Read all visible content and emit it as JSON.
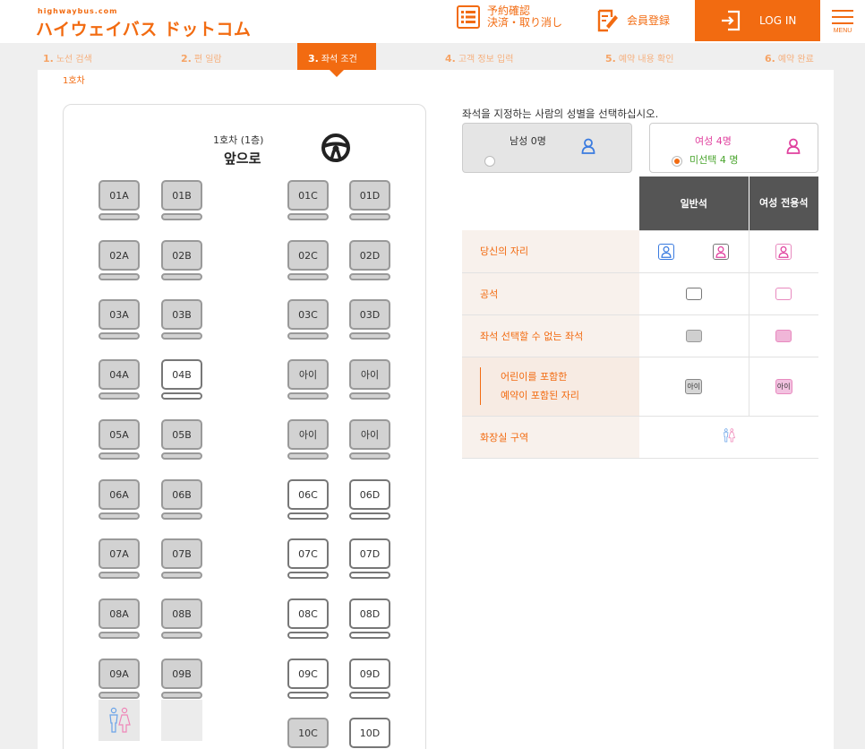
{
  "header": {
    "logo_small": "highwaybus.com",
    "logo": "ハイウェイバス ドットコム",
    "reservation_line1": "予約確認",
    "reservation_line2": "決済・取り消し",
    "member_label": "会員登録",
    "login_label": "LOG IN",
    "menu_label": "MENU",
    "accent": "#f26b11"
  },
  "steps": [
    {
      "num": "1.",
      "label": "노선 검색"
    },
    {
      "num": "2.",
      "label": "편 일람"
    },
    {
      "num": "3.",
      "label": "좌석 조건"
    },
    {
      "num": "4.",
      "label": "고객 정보 입력"
    },
    {
      "num": "5.",
      "label": "예약 내용 확인"
    },
    {
      "num": "6.",
      "label": "예약 완료"
    }
  ],
  "car_label": "1호차",
  "bus": {
    "title": "1호차 (1층)",
    "front": "앞으로",
    "seats": [
      {
        "label": "01A",
        "state": "occupied"
      },
      {
        "label": "01B",
        "state": "occupied"
      },
      {
        "label": "01C",
        "state": "occupied"
      },
      {
        "label": "01D",
        "state": "occupied"
      },
      {
        "label": "02A",
        "state": "occupied"
      },
      {
        "label": "02B",
        "state": "occupied"
      },
      {
        "label": "02C",
        "state": "occupied"
      },
      {
        "label": "02D",
        "state": "occupied"
      },
      {
        "label": "03A",
        "state": "occupied"
      },
      {
        "label": "03B",
        "state": "occupied"
      },
      {
        "label": "03C",
        "state": "occupied"
      },
      {
        "label": "03D",
        "state": "occupied"
      },
      {
        "label": "04A",
        "state": "occupied"
      },
      {
        "label": "04B",
        "state": "free"
      },
      {
        "label": "아이",
        "state": "occupied"
      },
      {
        "label": "아이",
        "state": "occupied"
      },
      {
        "label": "05A",
        "state": "occupied"
      },
      {
        "label": "05B",
        "state": "occupied"
      },
      {
        "label": "아이",
        "state": "occupied"
      },
      {
        "label": "아이",
        "state": "occupied"
      },
      {
        "label": "06A",
        "state": "occupied"
      },
      {
        "label": "06B",
        "state": "occupied"
      },
      {
        "label": "06C",
        "state": "free"
      },
      {
        "label": "06D",
        "state": "free"
      },
      {
        "label": "07A",
        "state": "occupied"
      },
      {
        "label": "07B",
        "state": "occupied"
      },
      {
        "label": "07C",
        "state": "free"
      },
      {
        "label": "07D",
        "state": "free"
      },
      {
        "label": "08A",
        "state": "occupied"
      },
      {
        "label": "08B",
        "state": "occupied"
      },
      {
        "label": "08C",
        "state": "free"
      },
      {
        "label": "08D",
        "state": "free"
      },
      {
        "label": "09A",
        "state": "occupied"
      },
      {
        "label": "09B",
        "state": "occupied"
      },
      {
        "label": "09C",
        "state": "free"
      },
      {
        "label": "09D",
        "state": "free"
      },
      {
        "label": "10C",
        "state": "occupied"
      },
      {
        "label": "10D",
        "state": "free"
      }
    ]
  },
  "gender": {
    "question": "좌석을 지정하는 사람의 성별을 선택하십시오.",
    "male_label": "남성 0명",
    "female_label": "여성 4명",
    "unselected_label": "미선택 4 명",
    "male_color": "#3a7be0",
    "female_color": "#e0409e",
    "unselected_color": "#4aa52e"
  },
  "legend": {
    "col_general": "일반석",
    "col_female": "여성 전용석",
    "rows": {
      "your_seat": "당신의 자리",
      "vacant": "공석",
      "unselectable": "좌석 선택할 수 없는 좌석",
      "child_line1": "어린이를 포함한",
      "child_line2": "예약이 포함된 자리",
      "restroom": "화장실 구역"
    },
    "kid_mark": "아이"
  }
}
